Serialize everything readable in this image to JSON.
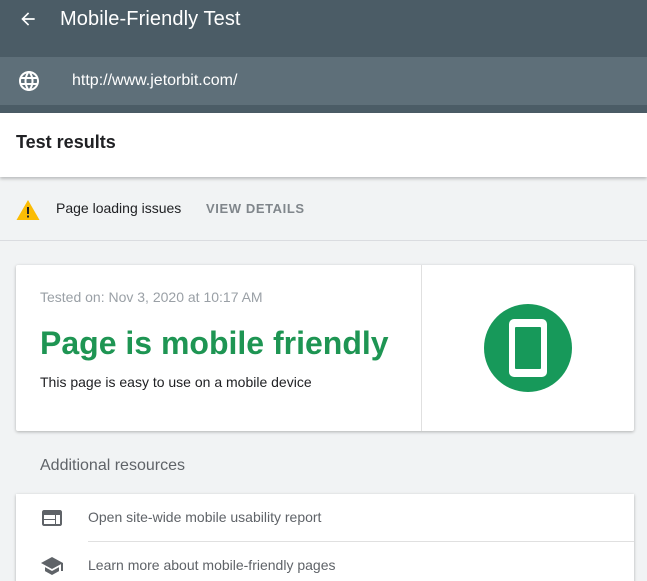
{
  "header": {
    "title": "Mobile-Friendly Test",
    "back_icon": "arrow-left-icon",
    "url": "http://www.jetorbit.com/",
    "url_icon": "globe-icon"
  },
  "results": {
    "title": "Test results"
  },
  "issues": {
    "icon": "warning-icon",
    "text": "Page loading issues",
    "action_label": "VIEW DETAILS"
  },
  "result_card": {
    "tested_on": "Tested on: Nov 3, 2020 at 10:17 AM",
    "verdict": "Page is mobile friendly",
    "description": "This page is easy to use on a mobile device",
    "badge_icon": "mobile-phone-icon"
  },
  "resources": {
    "heading": "Additional resources",
    "items": [
      {
        "label": "Open site-wide mobile usability report",
        "icon": "web-report-icon"
      },
      {
        "label": "Learn more about mobile-friendly pages",
        "icon": "school-icon"
      }
    ]
  },
  "colors": {
    "appbar": "#4b5c66",
    "url_bar": "#5e6f79",
    "success_text": "#1e9553",
    "success_badge": "#17995a",
    "warning": "#fbbc04"
  }
}
